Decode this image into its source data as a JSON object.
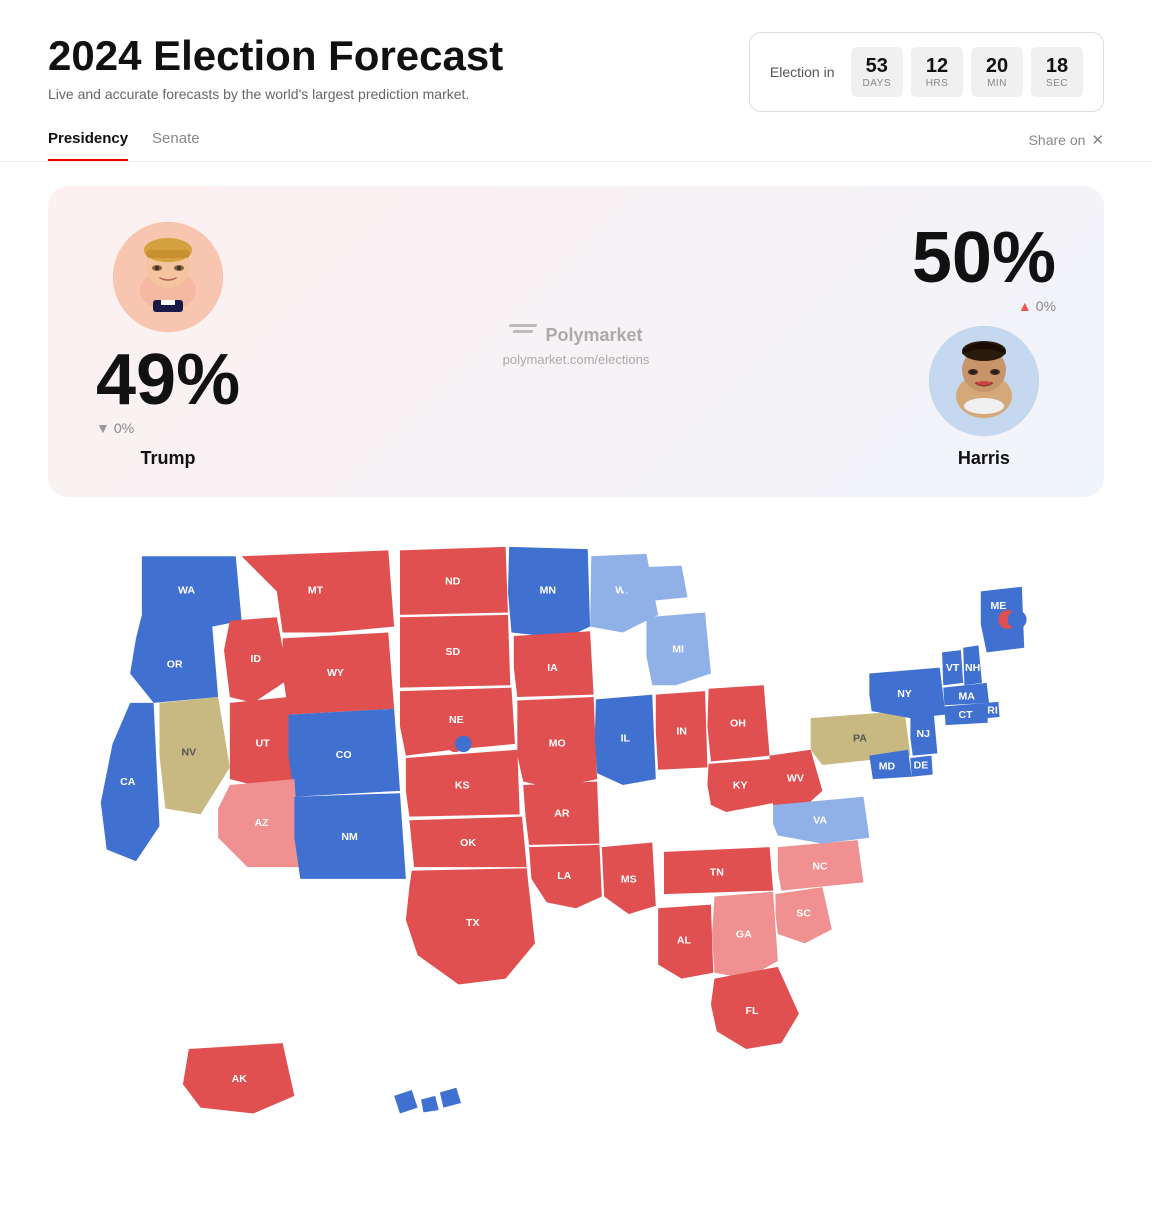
{
  "header": {
    "title": "2024 Election Forecast",
    "subtitle": "Live and accurate forecasts by the world's largest prediction market.",
    "countdown": {
      "label": "Election in",
      "days": {
        "value": "53",
        "unit": "DAYS"
      },
      "hrs": {
        "value": "12",
        "unit": "HRS"
      },
      "min": {
        "value": "20",
        "unit": "MIN"
      },
      "sec": {
        "value": "18",
        "unit": "SEC"
      }
    }
  },
  "tabs": {
    "items": [
      "Presidency",
      "Senate"
    ],
    "active": "Presidency"
  },
  "share": {
    "label": "Share on"
  },
  "forecast": {
    "trump": {
      "name": "Trump",
      "pct": "49%",
      "change": "▼ 0%"
    },
    "harris": {
      "name": "Harris",
      "pct": "50%",
      "change": "▲ 0%"
    },
    "brand": {
      "name": "Polymarket",
      "url": "polymarket.com/elections"
    }
  }
}
